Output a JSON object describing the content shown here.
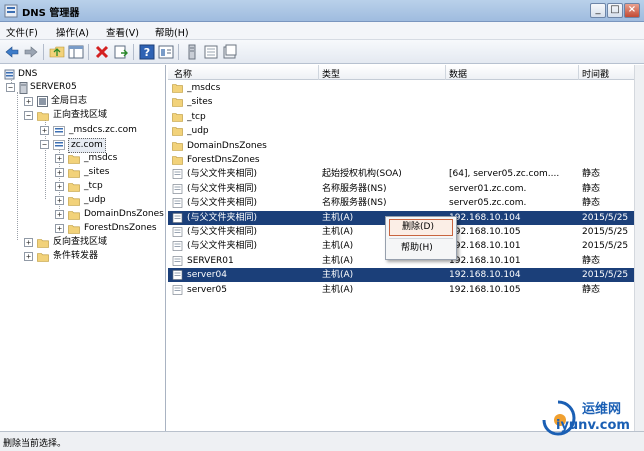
{
  "window": {
    "title": "DNS 管理器",
    "min": "_",
    "max": "□",
    "close": "×"
  },
  "menu": [
    "文件(F)",
    "操作(A)",
    "查看(V)",
    "帮助(H)"
  ],
  "tree": {
    "root": "DNS",
    "server": "SERVER05",
    "global_logs": "全局日志",
    "forward_zones": "正向查找区域",
    "msdcs_zone": "_msdcs.zc.com",
    "zc_zone": "zc.com",
    "zc_children": [
      "_msdcs",
      "_sites",
      "_tcp",
      "_udp",
      "DomainDnsZones",
      "ForestDnsZones"
    ],
    "reverse_zones": "反向查找区域",
    "conditional": "条件转发器"
  },
  "list": {
    "headers": [
      "名称",
      "类型",
      "数据",
      "时间戳"
    ],
    "rows": [
      {
        "name": "_msdcs",
        "type": "",
        "data": "",
        "time": ""
      },
      {
        "name": "_sites",
        "type": "",
        "data": "",
        "time": ""
      },
      {
        "name": "_tcp",
        "type": "",
        "data": "",
        "time": ""
      },
      {
        "name": "_udp",
        "type": "",
        "data": "",
        "time": ""
      },
      {
        "name": "DomainDnsZones",
        "type": "",
        "data": "",
        "time": ""
      },
      {
        "name": "ForestDnsZones",
        "type": "",
        "data": "",
        "time": ""
      },
      {
        "name": "(与父文件夹相同)",
        "type": "起始授权机构(SOA)",
        "data": "[64], server05.zc.com....",
        "time": "静态"
      },
      {
        "name": "(与父文件夹相同)",
        "type": "名称服务器(NS)",
        "data": "server01.zc.com.",
        "time": "静态"
      },
      {
        "name": "(与父文件夹相同)",
        "type": "名称服务器(NS)",
        "data": "server05.zc.com.",
        "time": "静态"
      },
      {
        "name": "(与父文件夹相同)",
        "type": "主机(A)",
        "data": "192.168.10.104",
        "time": "2015/5/25"
      },
      {
        "name": "(与父文件夹相同)",
        "type": "主机(A)",
        "data": "192.168.10.105",
        "time": "2015/5/25"
      },
      {
        "name": "(与父文件夹相同)",
        "type": "主机(A)",
        "data": "192.168.10.101",
        "time": "2015/5/25"
      },
      {
        "name": "SERVER01",
        "type": "主机(A)",
        "data": "192.168.10.101",
        "time": "静态"
      },
      {
        "name": "server04",
        "type": "主机(A)",
        "data": "192.168.10.104",
        "time": "2015/5/25"
      },
      {
        "name": "server05",
        "type": "主机(A)",
        "data": "192.168.10.105",
        "time": "静态"
      }
    ]
  },
  "context_menu": {
    "delete": "删除(D)",
    "help": "帮助(H)"
  },
  "status": "删除当前选择。",
  "watermark": {
    "line1": "运维网",
    "line2": "iyunv.com"
  },
  "colors": {
    "selection": "#1b3f79",
    "titlebar": "#b9d1ea",
    "folder": "#f2d27a"
  }
}
